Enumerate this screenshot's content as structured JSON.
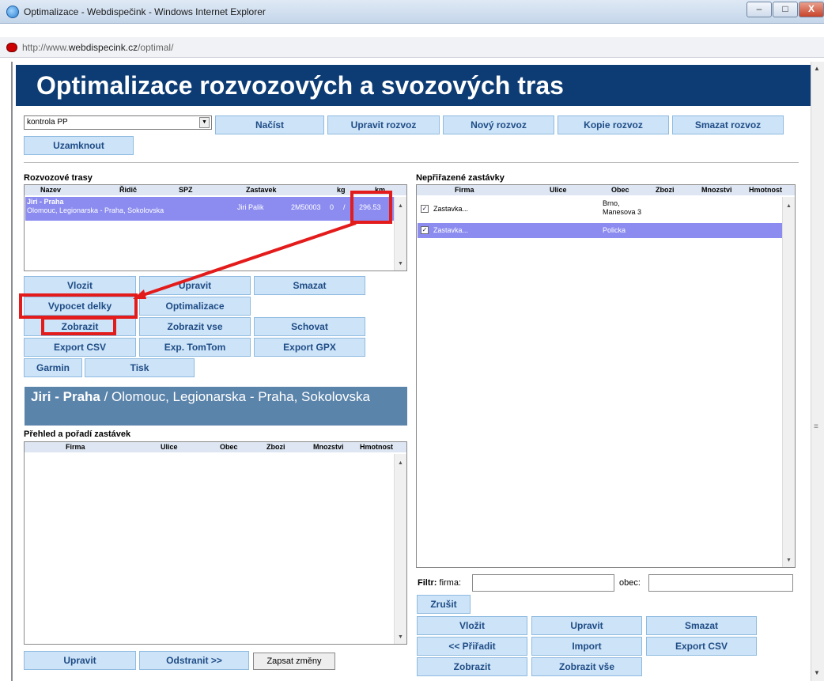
{
  "window": {
    "title": "Optimalizace - Webdispečink - Windows Internet Explorer",
    "address_prefix": "http://www.",
    "address_host": "webdispecink.cz",
    "address_path": "/optimal/",
    "controls": {
      "minimize": "–",
      "maximize": "□",
      "close": "X"
    }
  },
  "page": {
    "title": "Optimalizace rozvozových a svozových tras"
  },
  "top": {
    "selected_route": "kontrola PP",
    "buttons": {
      "load": "Načíst",
      "edit": "Upravit rozvoz",
      "new": "Nový rozvoz",
      "copy": "Kopie rozvoz",
      "delete": "Smazat rozvoz",
      "lock": "Uzamknout"
    }
  },
  "routes": {
    "label": "Rozvozové trasy",
    "columns": [
      "Nazev",
      "Řidič",
      "SPZ",
      "Zastavek",
      "kg",
      "km"
    ],
    "rows": [
      {
        "name": "Jiri - Praha",
        "description": "Olomouc, Legionarska - Praha, Sokolovska",
        "driver": "Jiri Palik",
        "spz": "2M50003",
        "stops": "0",
        "kg": "/",
        "km": "296.53"
      }
    ],
    "buttons": {
      "insert": "Vlozit",
      "edit": "Upravit",
      "delete": "Smazat",
      "calc": "Vypocet delky",
      "optimize": "Optimalizace",
      "show": "Zobrazit",
      "show_all": "Zobrazit vse",
      "hide": "Schovat",
      "export_csv": "Export CSV",
      "export_tomtom": "Exp. TomTom",
      "export_gpx": "Export GPX",
      "garmin": "Garmin",
      "print": "Tisk"
    }
  },
  "detail": {
    "title_bold": "Jiri - Praha",
    "title_rest": " / Olomouc, Legionarska - Praha, Sokolovska",
    "label": "Přehled a pořadí zastávek",
    "columns": [
      "Firma",
      "Ulice",
      "Obec",
      "Zbozi",
      "Mnozstvi",
      "Hmotnost"
    ],
    "buttons": {
      "edit": "Upravit",
      "remove": "Odstranit >>",
      "save": "Zapsat změny"
    }
  },
  "unassigned": {
    "label": "Nepřiřazené zastávky",
    "columns": [
      "Firma",
      "Ulice",
      "Obec",
      "Zbozi",
      "Mnozstvi",
      "Hmotnost"
    ],
    "rows": [
      {
        "firma": "Zastavka...",
        "obec_line1": "Brno,",
        "obec_line2": "Manesova 3",
        "checked": true,
        "selected": false
      },
      {
        "firma": "Zastavka...",
        "obec_line1": "Policka",
        "obec_line2": "",
        "checked": true,
        "selected": true
      }
    ],
    "filter": {
      "label": "Filtr:",
      "firma_label": "firma:",
      "obec_label": "obec:",
      "firma_value": "",
      "obec_value": "",
      "cancel": "Zrušit"
    },
    "buttons": {
      "insert": "Vložit",
      "edit": "Upravit",
      "delete": "Smazat",
      "assign": "<< Přiřadit",
      "import": "Import",
      "export_csv": "Export CSV",
      "show": "Zobrazit",
      "show_all": "Zobrazit vše"
    }
  },
  "icons": {
    "checkbox": "✓",
    "scroll_up": "▲",
    "scroll_down": "▼",
    "grip": "≡",
    "dropdown": "▼"
  },
  "colors": {
    "header_bg": "#0d3c74",
    "button_bg": "#cce3f8",
    "button_text": "#1f4c85",
    "selection": "#8c8cf0",
    "annotation": "#e31b1b",
    "detail_title_bg": "#5b84ab"
  }
}
